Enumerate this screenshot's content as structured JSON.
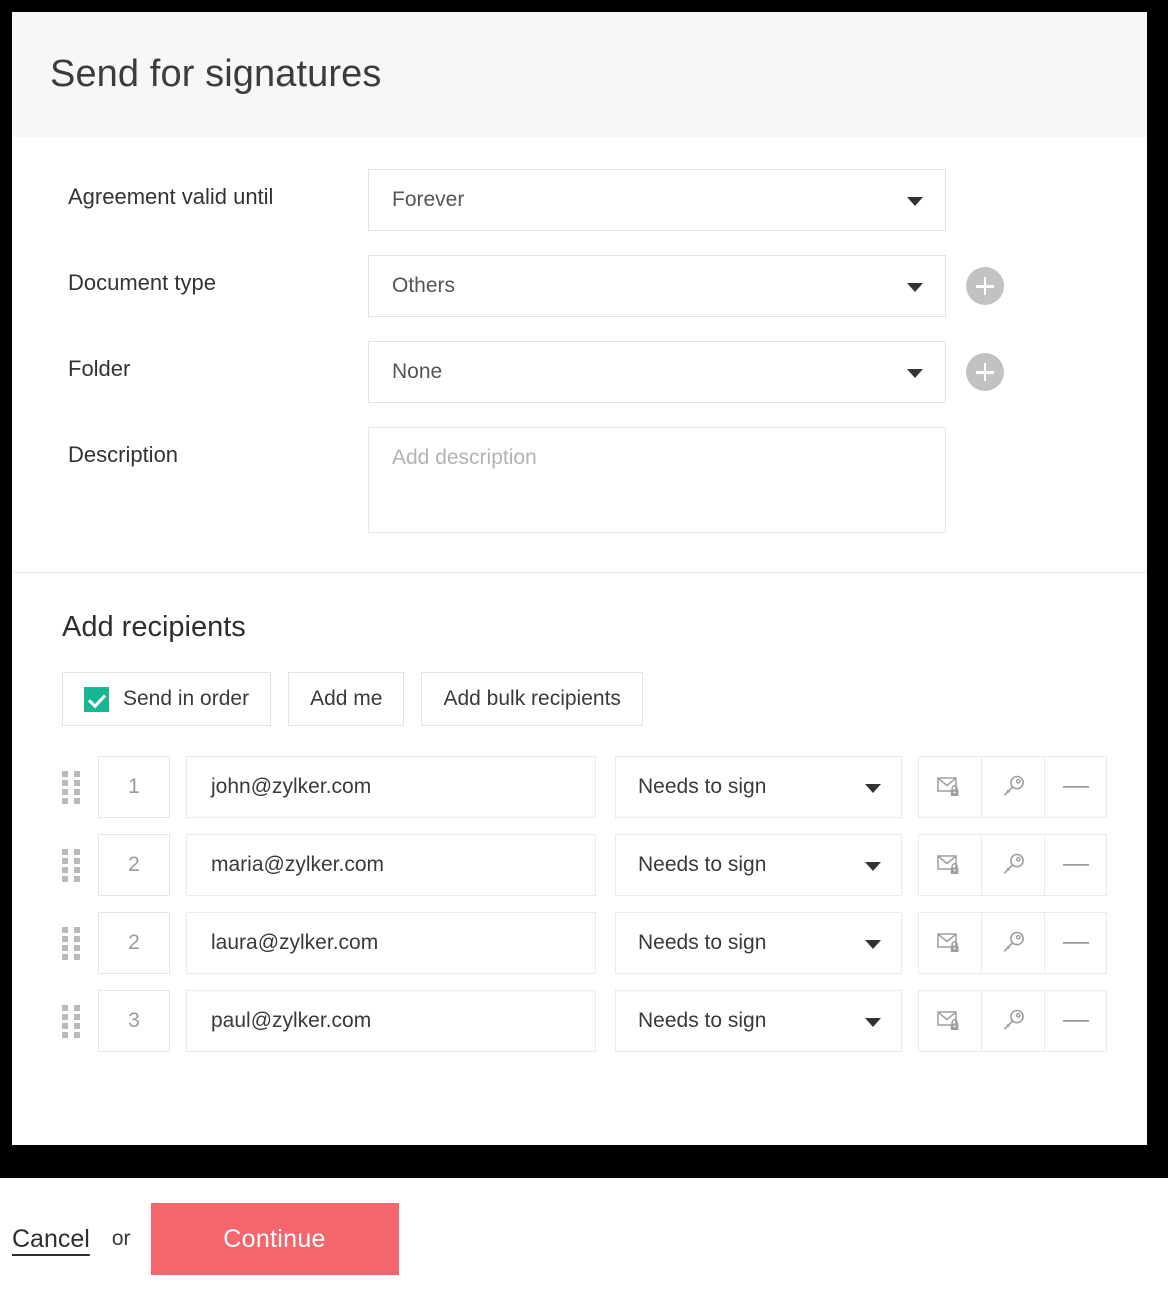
{
  "dialog": {
    "title": "Send for signatures"
  },
  "form": {
    "fields": [
      {
        "label": "Agreement valid until",
        "value": "Forever",
        "type": "select",
        "has_add_button": false
      },
      {
        "label": "Document type",
        "value": "Others",
        "type": "select",
        "has_add_button": true
      },
      {
        "label": "Folder",
        "value": "None",
        "type": "select",
        "has_add_button": true
      },
      {
        "label": "Description",
        "value": "",
        "placeholder": "Add description",
        "type": "textarea",
        "has_add_button": false
      }
    ],
    "add_button_icon": "plus-icon"
  },
  "recipients": {
    "title": "Add recipients",
    "toolbar": {
      "send_in_order_label": "Send in order",
      "send_in_order_checked": true,
      "add_me_label": "Add me",
      "add_bulk_label": "Add bulk recipients"
    },
    "rows": [
      {
        "order": "1",
        "email": "john@zylker.com",
        "role": "Needs to sign",
        "actions": [
          "private-message-icon",
          "access-code-icon",
          "remove-icon"
        ]
      },
      {
        "order": "2",
        "email": "maria@zylker.com",
        "role": "Needs to sign",
        "actions": [
          "private-message-icon",
          "access-code-icon",
          "remove-icon"
        ]
      },
      {
        "order": "2",
        "email": "laura@zylker.com",
        "role": "Needs to sign",
        "actions": [
          "private-message-icon",
          "access-code-icon",
          "remove-icon"
        ]
      },
      {
        "order": "3",
        "email": "paul@zylker.com",
        "role": "Needs to sign",
        "actions": [
          "private-message-icon",
          "access-code-icon",
          "remove-icon"
        ]
      }
    ]
  },
  "footer": {
    "cancel_label": "Cancel",
    "or_label": "or",
    "continue_label": "Continue"
  },
  "colors": {
    "accent_primary": "#f4666b",
    "checkbox_green": "#17b791",
    "header_background": "#f7f7f7",
    "add_button_gray": "#c2c2c2",
    "backdrop": "#000000"
  }
}
